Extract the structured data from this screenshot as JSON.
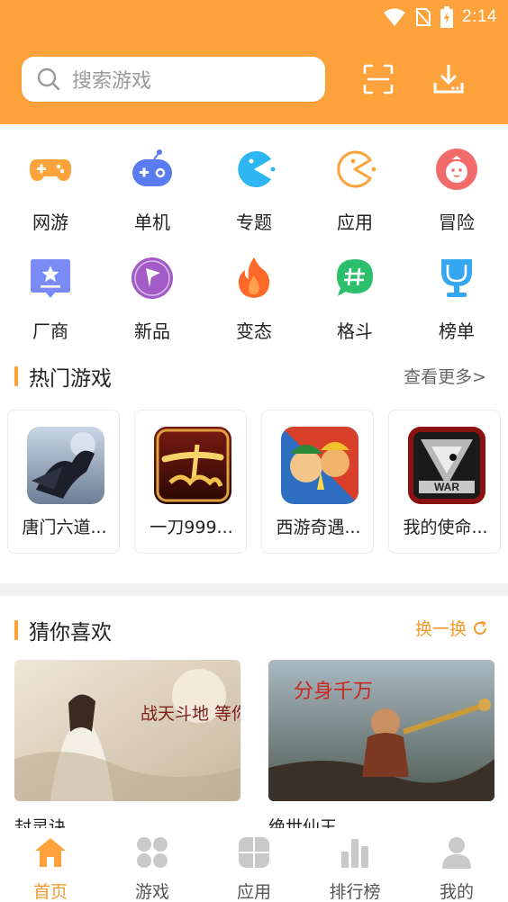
{
  "status": {
    "time": "2:14"
  },
  "search": {
    "placeholder": "搜索游戏"
  },
  "categories": [
    {
      "label": "网游",
      "icon": "gamepad-icon",
      "color": "#FEA33B"
    },
    {
      "label": "单机",
      "icon": "controller-icon",
      "color": "#5B7CF0"
    },
    {
      "label": "专题",
      "icon": "pacman-icon",
      "color": "#2DB6F0"
    },
    {
      "label": "应用",
      "icon": "pacman-outline-icon",
      "color": "#FEA33B"
    },
    {
      "label": "冒险",
      "icon": "face-icon",
      "color": "#F26B6B"
    },
    {
      "label": "厂商",
      "icon": "star-card-icon",
      "color": "#7B8BF5"
    },
    {
      "label": "新品",
      "icon": "flag-circle-icon",
      "color": "#A35CC7"
    },
    {
      "label": "变态",
      "icon": "flame-icon",
      "color": "#FF6A2B"
    },
    {
      "label": "格斗",
      "icon": "hash-bubble-icon",
      "color": "#2DBE6C"
    },
    {
      "label": "榜单",
      "icon": "trophy-icon",
      "color": "#35A6F0"
    }
  ],
  "hot": {
    "title": "热门游戏",
    "more": "查看更多>",
    "games": [
      {
        "name": "唐门六道..."
      },
      {
        "name": "一刀999..."
      },
      {
        "name": "西游奇遇..."
      },
      {
        "name": "我的使命..."
      }
    ]
  },
  "like": {
    "title": "猜你喜欢",
    "refresh": "换一换",
    "items": [
      {
        "name": "封灵诀",
        "banner_text": "战天斗地 等你封神"
      },
      {
        "name": "绝世仙王",
        "banner_text": "分身千万"
      }
    ]
  },
  "tabs": [
    {
      "label": "首页",
      "icon": "home-icon"
    },
    {
      "label": "游戏",
      "icon": "grid-icon"
    },
    {
      "label": "应用",
      "icon": "apps-icon"
    },
    {
      "label": "排行榜",
      "icon": "ranking-icon"
    },
    {
      "label": "我的",
      "icon": "user-icon"
    }
  ],
  "colors": {
    "accent": "#FEA33B",
    "accent_text": "#F39A2E"
  }
}
